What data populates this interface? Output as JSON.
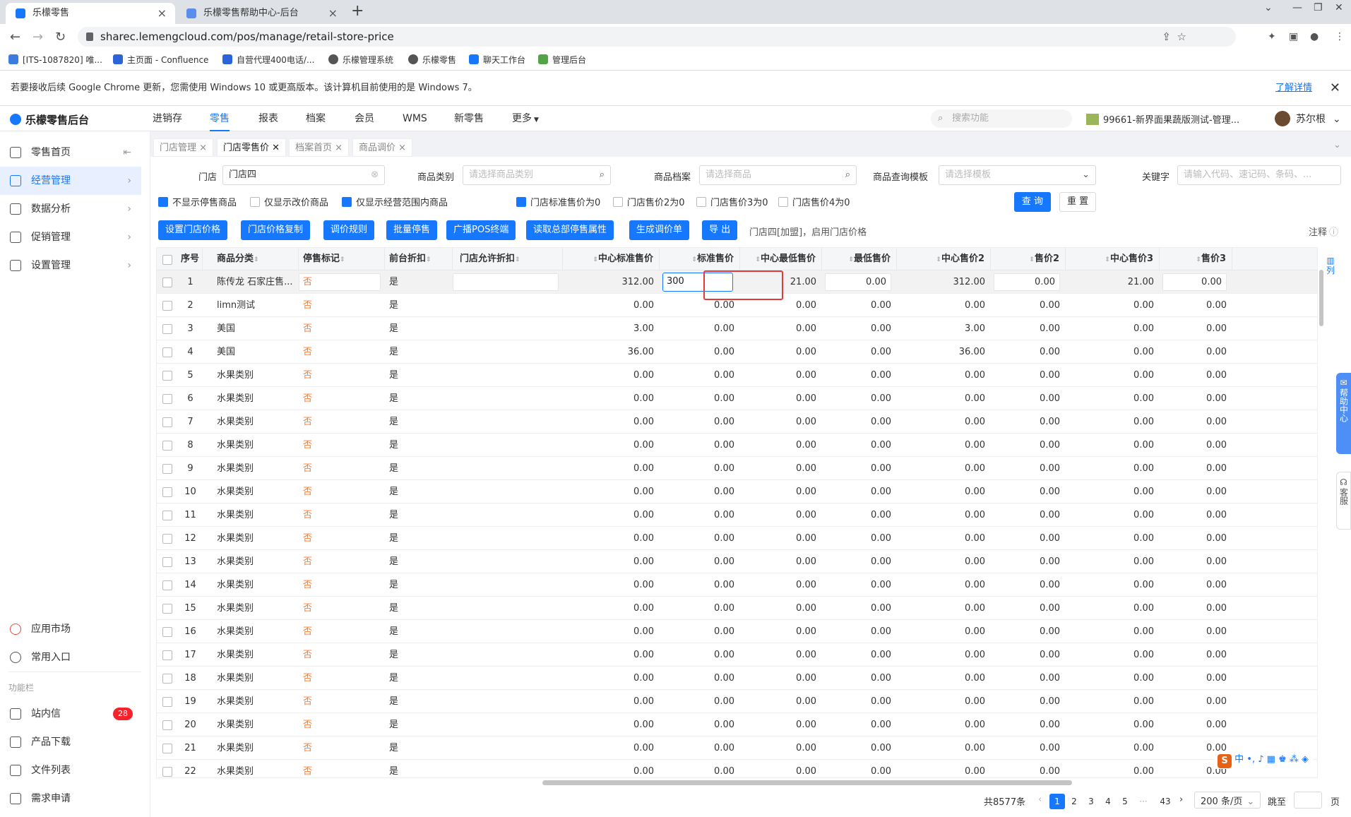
{
  "browser": {
    "tabs": [
      {
        "label": "乐檬零售",
        "active": true
      },
      {
        "label": "乐檬零售帮助中心-后台",
        "active": false
      }
    ],
    "url": "sharec.lemengcloud.com/pos/manage/retail-store-price",
    "bookmarks": [
      "[ITS-1087820] 唯...",
      "主页面 - Confluence",
      "自营代理400电话/...",
      "乐檬管理系统",
      "乐檬零售",
      "聊天工作台",
      "管理后台"
    ],
    "infobar_text": "若要接收后续 Google Chrome 更新，您需使用 Windows 10 或更高版本。该计算机目前使用的是 Windows 7。",
    "infobar_link": "了解详情"
  },
  "app": {
    "logo": "乐檬零售后台",
    "nav": [
      "进销存",
      "零售",
      "报表",
      "档案",
      "会员",
      "WMS",
      "新零售",
      "更多"
    ],
    "active_nav": "零售",
    "search_placeholder": "搜索功能",
    "store": "99661-新界面果蔬版测试-管理...",
    "user": "苏尔根"
  },
  "sidebar": {
    "items": [
      {
        "label": "零售首页",
        "active": false
      },
      {
        "label": "经营管理",
        "active": true
      },
      {
        "label": "数据分析",
        "active": false
      },
      {
        "label": "促销管理",
        "active": false
      },
      {
        "label": "设置管理",
        "active": false
      }
    ],
    "bottom": [
      "应用市场",
      "常用入口"
    ],
    "group_label": "功能栏",
    "functions": [
      {
        "label": "站内信",
        "badge": "28"
      },
      {
        "label": "产品下载"
      },
      {
        "label": "文件列表"
      },
      {
        "label": "需求申请"
      }
    ]
  },
  "page_tabs": [
    "门店管理",
    "门店零售价",
    "档案首页",
    "商品调价"
  ],
  "active_page_tab": "门店零售价",
  "filters": {
    "store_label": "门店",
    "store_value": "门店四",
    "category_label": "商品类别",
    "category_placeholder": "请选择商品类别",
    "product_label": "商品档案",
    "product_placeholder": "请选择商品",
    "template_label": "商品查询模板",
    "template_placeholder": "请选择模板",
    "keyword_label": "关键字",
    "keyword_placeholder": "请输入代码、速记码、条码、..."
  },
  "checkboxes": [
    {
      "label": "不显示停售商品",
      "checked": true
    },
    {
      "label": "仅显示改价商品",
      "checked": false
    },
    {
      "label": "仅显示经营范围内商品",
      "checked": true
    },
    {
      "label": "门店标准售价为0",
      "checked": true
    },
    {
      "label": "门店售价2为0",
      "checked": false
    },
    {
      "label": "门店售价3为0",
      "checked": false
    },
    {
      "label": "门店售价4为0",
      "checked": false
    }
  ],
  "query_btn": "查 询",
  "reset_btn": "重 置",
  "actions": [
    "设置门店价格",
    "门店价格复制",
    "调价规则",
    "批量停售",
    "广播POS终端",
    "读取总部停售属性",
    "生成调价单",
    "导 出"
  ],
  "store_note": "门店四[加盟]，启用门店价格",
  "annotation": "注释",
  "col_settings": "列",
  "columns": [
    "序号",
    "商品分类",
    "停售标记",
    "前台折扣",
    "门店允许折扣",
    "中心标准售价",
    "标准售价",
    "中心最低售价",
    "最低售价",
    "中心售价2",
    "售价2",
    "中心售价3",
    "售价3"
  ],
  "rows": [
    {
      "no": "1",
      "cat": "陈传龙 石家庄售...",
      "stop": "否",
      "disc": "是",
      "center_std": "312.00",
      "std": "300",
      "center_min": "21.00",
      "min": "0.00",
      "center_p2": "312.00",
      "p2": "0.00",
      "center_p3": "21.00",
      "p3": "0.00"
    },
    {
      "no": "2",
      "cat": "limn测试",
      "stop": "否",
      "disc": "是",
      "center_std": "0.00",
      "std": "0.00",
      "center_min": "0.00",
      "min": "0.00",
      "center_p2": "0.00",
      "p2": "0.00",
      "center_p3": "0.00",
      "p3": "0.00"
    },
    {
      "no": "3",
      "cat": "美国",
      "stop": "否",
      "disc": "是",
      "center_std": "3.00",
      "std": "0.00",
      "center_min": "0.00",
      "min": "0.00",
      "center_p2": "3.00",
      "p2": "0.00",
      "center_p3": "0.00",
      "p3": "0.00"
    },
    {
      "no": "4",
      "cat": "美国",
      "stop": "否",
      "disc": "是",
      "center_std": "36.00",
      "std": "0.00",
      "center_min": "0.00",
      "min": "0.00",
      "center_p2": "36.00",
      "p2": "0.00",
      "center_p3": "0.00",
      "p3": "0.00"
    },
    {
      "no": "5",
      "cat": "水果类别",
      "stop": "否",
      "disc": "是",
      "center_std": "0.00",
      "std": "0.00",
      "center_min": "0.00",
      "min": "0.00",
      "center_p2": "0.00",
      "p2": "0.00",
      "center_p3": "0.00",
      "p3": "0.00"
    },
    {
      "no": "6",
      "cat": "水果类别",
      "stop": "否",
      "disc": "是",
      "center_std": "0.00",
      "std": "0.00",
      "center_min": "0.00",
      "min": "0.00",
      "center_p2": "0.00",
      "p2": "0.00",
      "center_p3": "0.00",
      "p3": "0.00"
    },
    {
      "no": "7",
      "cat": "水果类别",
      "stop": "否",
      "disc": "是",
      "center_std": "0.00",
      "std": "0.00",
      "center_min": "0.00",
      "min": "0.00",
      "center_p2": "0.00",
      "p2": "0.00",
      "center_p3": "0.00",
      "p3": "0.00"
    },
    {
      "no": "8",
      "cat": "水果类别",
      "stop": "否",
      "disc": "是",
      "center_std": "0.00",
      "std": "0.00",
      "center_min": "0.00",
      "min": "0.00",
      "center_p2": "0.00",
      "p2": "0.00",
      "center_p3": "0.00",
      "p3": "0.00"
    },
    {
      "no": "9",
      "cat": "水果类别",
      "stop": "否",
      "disc": "是",
      "center_std": "0.00",
      "std": "0.00",
      "center_min": "0.00",
      "min": "0.00",
      "center_p2": "0.00",
      "p2": "0.00",
      "center_p3": "0.00",
      "p3": "0.00"
    },
    {
      "no": "10",
      "cat": "水果类别",
      "stop": "否",
      "disc": "是",
      "center_std": "0.00",
      "std": "0.00",
      "center_min": "0.00",
      "min": "0.00",
      "center_p2": "0.00",
      "p2": "0.00",
      "center_p3": "0.00",
      "p3": "0.00"
    },
    {
      "no": "11",
      "cat": "水果类别",
      "stop": "否",
      "disc": "是",
      "center_std": "0.00",
      "std": "0.00",
      "center_min": "0.00",
      "min": "0.00",
      "center_p2": "0.00",
      "p2": "0.00",
      "center_p3": "0.00",
      "p3": "0.00"
    },
    {
      "no": "12",
      "cat": "水果类别",
      "stop": "否",
      "disc": "是",
      "center_std": "0.00",
      "std": "0.00",
      "center_min": "0.00",
      "min": "0.00",
      "center_p2": "0.00",
      "p2": "0.00",
      "center_p3": "0.00",
      "p3": "0.00"
    },
    {
      "no": "13",
      "cat": "水果类别",
      "stop": "否",
      "disc": "是",
      "center_std": "0.00",
      "std": "0.00",
      "center_min": "0.00",
      "min": "0.00",
      "center_p2": "0.00",
      "p2": "0.00",
      "center_p3": "0.00",
      "p3": "0.00"
    },
    {
      "no": "14",
      "cat": "水果类别",
      "stop": "否",
      "disc": "是",
      "center_std": "0.00",
      "std": "0.00",
      "center_min": "0.00",
      "min": "0.00",
      "center_p2": "0.00",
      "p2": "0.00",
      "center_p3": "0.00",
      "p3": "0.00"
    },
    {
      "no": "15",
      "cat": "水果类别",
      "stop": "否",
      "disc": "是",
      "center_std": "0.00",
      "std": "0.00",
      "center_min": "0.00",
      "min": "0.00",
      "center_p2": "0.00",
      "p2": "0.00",
      "center_p3": "0.00",
      "p3": "0.00"
    },
    {
      "no": "16",
      "cat": "水果类别",
      "stop": "否",
      "disc": "是",
      "center_std": "0.00",
      "std": "0.00",
      "center_min": "0.00",
      "min": "0.00",
      "center_p2": "0.00",
      "p2": "0.00",
      "center_p3": "0.00",
      "p3": "0.00"
    },
    {
      "no": "17",
      "cat": "水果类别",
      "stop": "否",
      "disc": "是",
      "center_std": "0.00",
      "std": "0.00",
      "center_min": "0.00",
      "min": "0.00",
      "center_p2": "0.00",
      "p2": "0.00",
      "center_p3": "0.00",
      "p3": "0.00"
    },
    {
      "no": "18",
      "cat": "水果类别",
      "stop": "否",
      "disc": "是",
      "center_std": "0.00",
      "std": "0.00",
      "center_min": "0.00",
      "min": "0.00",
      "center_p2": "0.00",
      "p2": "0.00",
      "center_p3": "0.00",
      "p3": "0.00"
    },
    {
      "no": "19",
      "cat": "水果类别",
      "stop": "否",
      "disc": "是",
      "center_std": "0.00",
      "std": "0.00",
      "center_min": "0.00",
      "min": "0.00",
      "center_p2": "0.00",
      "p2": "0.00",
      "center_p3": "0.00",
      "p3": "0.00"
    },
    {
      "no": "20",
      "cat": "水果类别",
      "stop": "否",
      "disc": "是",
      "center_std": "0.00",
      "std": "0.00",
      "center_min": "0.00",
      "min": "0.00",
      "center_p2": "0.00",
      "p2": "0.00",
      "center_p3": "0.00",
      "p3": "0.00"
    },
    {
      "no": "21",
      "cat": "水果类别",
      "stop": "否",
      "disc": "是",
      "center_std": "0.00",
      "std": "0.00",
      "center_min": "0.00",
      "min": "0.00",
      "center_p2": "0.00",
      "p2": "0.00",
      "center_p3": "0.00",
      "p3": "0.00"
    },
    {
      "no": "22",
      "cat": "水果类别",
      "stop": "否",
      "disc": "是",
      "center_std": "0.00",
      "std": "0.00",
      "center_min": "0.00",
      "min": "0.00",
      "center_p2": "0.00",
      "p2": "0.00",
      "center_p3": "0.00",
      "p3": "0.00"
    }
  ],
  "pagination": {
    "total": "共8577条",
    "pages": [
      "1",
      "2",
      "3",
      "4",
      "5",
      "···",
      "43"
    ],
    "page_size": "200 条/页",
    "jump_label": "跳至",
    "page_unit": "页"
  },
  "float_help": "帮助中心",
  "float_service": "客服",
  "ime": "中"
}
